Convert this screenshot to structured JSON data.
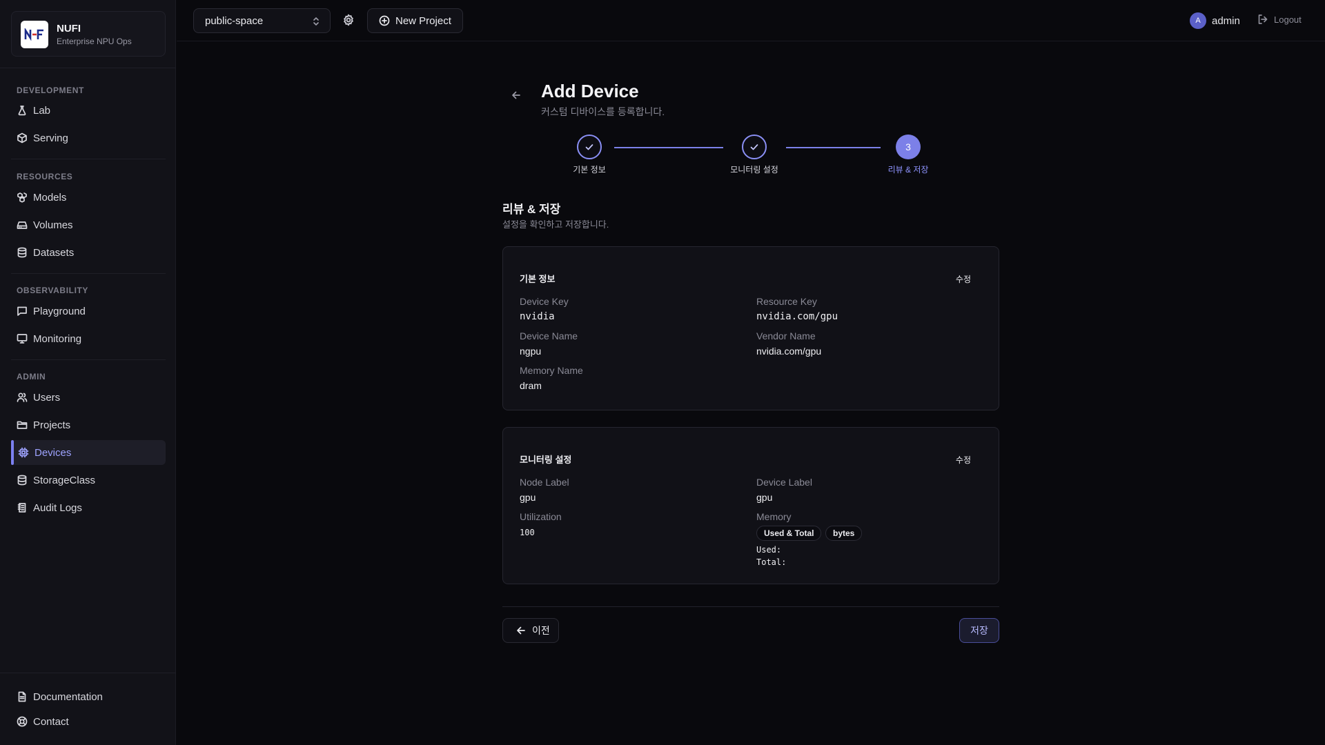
{
  "brand": {
    "name": "NUFI",
    "subtitle": "Enterprise NPU Ops"
  },
  "sidebar": {
    "sections": [
      {
        "title": "DEVELOPMENT",
        "items": [
          {
            "label": "Lab",
            "icon": "flask-icon"
          },
          {
            "label": "Serving",
            "icon": "cube-icon"
          }
        ]
      },
      {
        "title": "RESOURCES",
        "items": [
          {
            "label": "Models",
            "icon": "boxes-icon"
          },
          {
            "label": "Volumes",
            "icon": "drive-icon"
          },
          {
            "label": "Datasets",
            "icon": "database-icon"
          }
        ]
      },
      {
        "title": "OBSERVABILITY",
        "items": [
          {
            "label": "Playground",
            "icon": "chat-icon"
          },
          {
            "label": "Monitoring",
            "icon": "monitor-icon"
          }
        ]
      },
      {
        "title": "ADMIN",
        "items": [
          {
            "label": "Users",
            "icon": "users-icon"
          },
          {
            "label": "Projects",
            "icon": "folder-icon"
          },
          {
            "label": "Devices",
            "icon": "chip-icon",
            "active": true
          },
          {
            "label": "StorageClass",
            "icon": "database-icon"
          },
          {
            "label": "Audit Logs",
            "icon": "log-icon"
          }
        ]
      }
    ],
    "footer": [
      {
        "label": "Documentation",
        "icon": "document-icon"
      },
      {
        "label": "Contact",
        "icon": "lifebuoy-icon"
      }
    ]
  },
  "topbar": {
    "project": "public-space",
    "new_project": "New Project",
    "user_initial": "A",
    "user_name": "admin",
    "logout": "Logout"
  },
  "page": {
    "title": "Add Device",
    "subtitle": "커스텀 디바이스를 등록합니다.",
    "steps": [
      {
        "label": "기본 정보",
        "state": "done"
      },
      {
        "label": "모니터링 설정",
        "state": "done"
      },
      {
        "label": "리뷰 & 저장",
        "state": "current",
        "number": "3"
      }
    ],
    "section_title": "리뷰 & 저장",
    "section_subtitle": "설정을 확인하고 저장합니다."
  },
  "basic_card": {
    "title": "기본 정보",
    "edit": "수정",
    "device_key_label": "Device Key",
    "device_key": "nvidia",
    "resource_key_label": "Resource Key",
    "resource_key": "nvidia.com/gpu",
    "device_name_label": "Device Name",
    "device_name": "ngpu",
    "vendor_name_label": "Vendor Name",
    "vendor_name": "nvidia.com/gpu",
    "memory_name_label": "Memory Name",
    "memory_name": "dram"
  },
  "monitor_card": {
    "title": "모니터링 설정",
    "edit": "수정",
    "node_label_label": "Node Label",
    "node_label": "gpu",
    "device_label_label": "Device Label",
    "device_label": "gpu",
    "utilization_label": "Utilization",
    "utilization": "100",
    "memory_label": "Memory",
    "memory_mode": "Used & Total",
    "memory_unit": "bytes",
    "used_label": "Used:",
    "total_label": "Total:"
  },
  "actions": {
    "prev": "이전",
    "save": "저장"
  },
  "colors": {
    "accent": "#7c80e8",
    "background": "#09090d",
    "sidebar": "#121218"
  }
}
